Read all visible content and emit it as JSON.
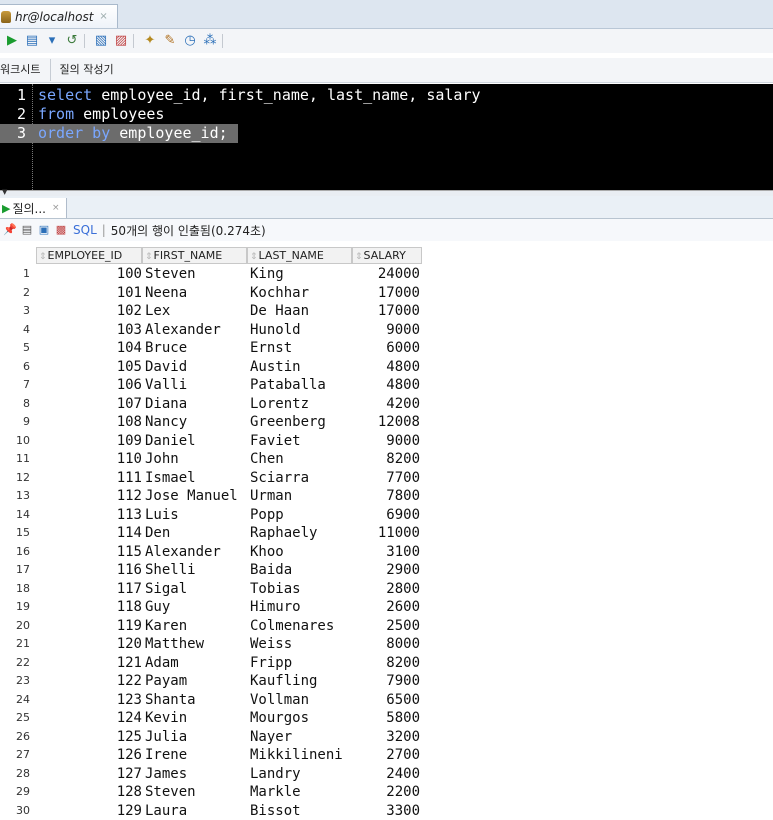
{
  "connection_tab": {
    "label": "hr@localhost",
    "close": "×"
  },
  "toolbar": {
    "icons": [
      "run-statement-icon",
      "run-script-icon",
      "commit-icon",
      "rollback-icon",
      "explain-plan-icon",
      "autotrace-icon",
      "sql-tuning-icon",
      "clear-icon",
      "history-icon",
      "unshared-icon"
    ]
  },
  "subtabs": [
    "워크시트",
    "질의 작성기"
  ],
  "editor": {
    "lines": [
      {
        "no": "1",
        "text": "select employee_id, first_name, last_name, salary"
      },
      {
        "no": "2",
        "text": "from employees"
      },
      {
        "no": "3",
        "text": "order by employee_id;"
      }
    ]
  },
  "results": {
    "tab_label": "질의...",
    "tab_close": "×",
    "sql_label": "SQL",
    "status": "50개의 행이 인출됨(0.274초)",
    "columns": [
      "EMPLOYEE_ID",
      "FIRST_NAME",
      "LAST_NAME",
      "SALARY"
    ],
    "rows": [
      [
        "1",
        "100",
        "Steven",
        "King",
        "24000"
      ],
      [
        "2",
        "101",
        "Neena",
        "Kochhar",
        "17000"
      ],
      [
        "3",
        "102",
        "Lex",
        "De Haan",
        "17000"
      ],
      [
        "4",
        "103",
        "Alexander",
        "Hunold",
        "9000"
      ],
      [
        "5",
        "104",
        "Bruce",
        "Ernst",
        "6000"
      ],
      [
        "6",
        "105",
        "David",
        "Austin",
        "4800"
      ],
      [
        "7",
        "106",
        "Valli",
        "Pataballa",
        "4800"
      ],
      [
        "8",
        "107",
        "Diana",
        "Lorentz",
        "4200"
      ],
      [
        "9",
        "108",
        "Nancy",
        "Greenberg",
        "12008"
      ],
      [
        "10",
        "109",
        "Daniel",
        "Faviet",
        "9000"
      ],
      [
        "11",
        "110",
        "John",
        "Chen",
        "8200"
      ],
      [
        "12",
        "111",
        "Ismael",
        "Sciarra",
        "7700"
      ],
      [
        "13",
        "112",
        "Jose Manuel",
        "Urman",
        "7800"
      ],
      [
        "14",
        "113",
        "Luis",
        "Popp",
        "6900"
      ],
      [
        "15",
        "114",
        "Den",
        "Raphaely",
        "11000"
      ],
      [
        "16",
        "115",
        "Alexander",
        "Khoo",
        "3100"
      ],
      [
        "17",
        "116",
        "Shelli",
        "Baida",
        "2900"
      ],
      [
        "18",
        "117",
        "Sigal",
        "Tobias",
        "2800"
      ],
      [
        "19",
        "118",
        "Guy",
        "Himuro",
        "2600"
      ],
      [
        "20",
        "119",
        "Karen",
        "Colmenares",
        "2500"
      ],
      [
        "21",
        "120",
        "Matthew",
        "Weiss",
        "8000"
      ],
      [
        "22",
        "121",
        "Adam",
        "Fripp",
        "8200"
      ],
      [
        "23",
        "122",
        "Payam",
        "Kaufling",
        "7900"
      ],
      [
        "24",
        "123",
        "Shanta",
        "Vollman",
        "6500"
      ],
      [
        "25",
        "124",
        "Kevin",
        "Mourgos",
        "5800"
      ],
      [
        "26",
        "125",
        "Julia",
        "Nayer",
        "3200"
      ],
      [
        "27",
        "126",
        "Irene",
        "Mikkilineni",
        "2700"
      ],
      [
        "28",
        "127",
        "James",
        "Landry",
        "2400"
      ],
      [
        "29",
        "128",
        "Steven",
        "Markle",
        "2200"
      ],
      [
        "30",
        "129",
        "Laura",
        "Bissot",
        "3300"
      ]
    ]
  }
}
